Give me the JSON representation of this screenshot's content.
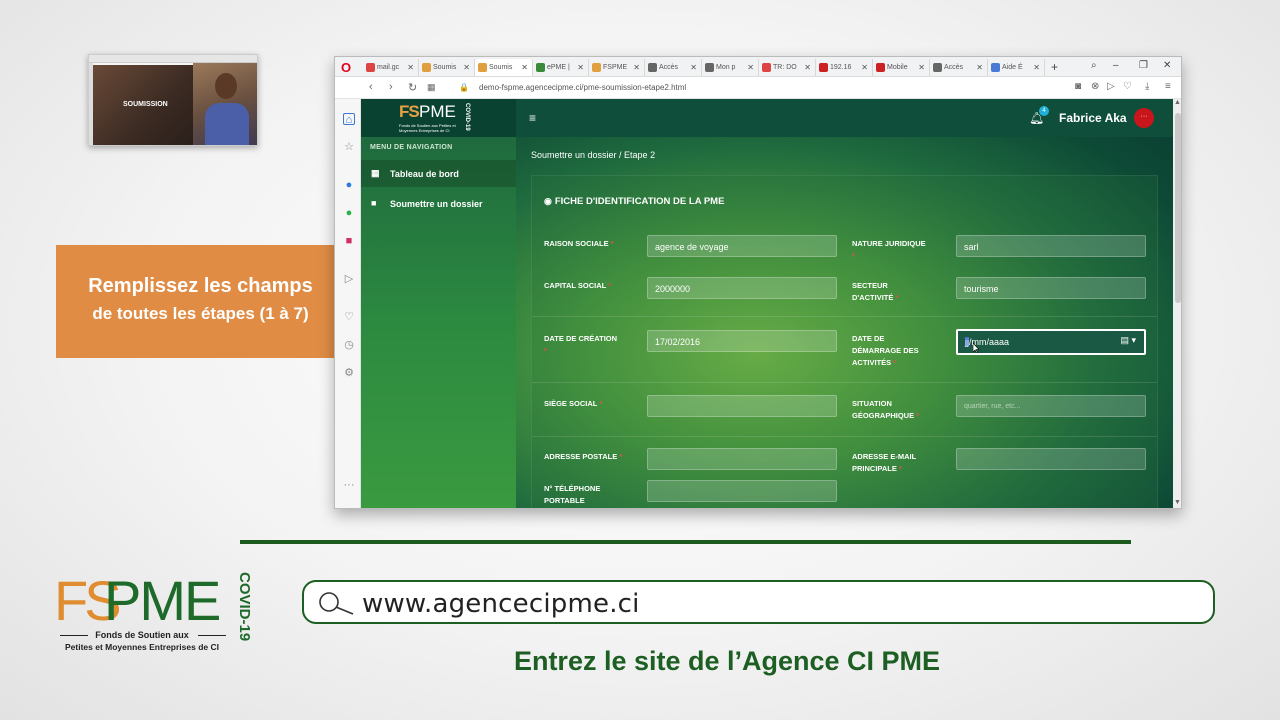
{
  "thumbnail": {
    "site_text": "SOUMISSION"
  },
  "callout": {
    "line1": "Remplissez les champs",
    "line2": "de toutes les étapes (1 à 7)"
  },
  "browser": {
    "tabs": [
      {
        "label": "mail.gc",
        "color": "#d44"
      },
      {
        "label": "Soumis",
        "color": "#e0a040"
      },
      {
        "label": "Soumis",
        "color": "#e0a040",
        "active": true
      },
      {
        "label": "ePME |",
        "color": "#3a8a3a"
      },
      {
        "label": "FSPME",
        "color": "#e0a040"
      },
      {
        "label": "Accès",
        "color": "#666"
      },
      {
        "label": "Mon p",
        "color": "#666"
      },
      {
        "label": "TR: DO",
        "color": "#d44"
      },
      {
        "label": "192.16",
        "color": "#c22"
      },
      {
        "label": "Mobile",
        "color": "#c22"
      },
      {
        "label": "Accès",
        "color": "#666"
      },
      {
        "label": "Aide É",
        "color": "#4a7ad4"
      }
    ],
    "url": "demo-fspme.agencecipme.ci/pme-soumission-etape2.html"
  },
  "app": {
    "logo_fs": "FS",
    "logo_pme": "PME",
    "logo_sub": "Fonds de Soutien aux Petites et Moyennes Entreprises de CI",
    "logo_covid": "COVID-19",
    "notif_count": "4",
    "user_name": "Fabrice Aka",
    "avatar": "···",
    "nav_title": "MENU DE NAVIGATION",
    "nav_items": [
      "Tableau de bord",
      "Soumettre un dossier"
    ],
    "breadcrumb": "Soumettre un dossier  /  Etape 2",
    "card_title": "FICHE D'IDENTIFICATION DE LA PME",
    "fields": {
      "raison_sociale": {
        "label": "RAISON SOCIALE",
        "value": "agence de voyage"
      },
      "nature_juridique": {
        "label": "NATURE JURIDIQUE",
        "value": "sarl"
      },
      "capital_social": {
        "label": "CAPITAL SOCIAL",
        "value": "2000000"
      },
      "secteur_activite": {
        "label1": "SECTEUR",
        "label2": "D'ACTIVITÉ",
        "value": "tourisme"
      },
      "date_creation": {
        "label": "DATE DE CRÉATION",
        "value": "17/02/2016"
      },
      "date_demarrage": {
        "label1": "DATE DE",
        "label2": "DÉMARRAGE DES",
        "label3": "ACTIVITÉS",
        "value_sel": "jj",
        "value_rest": "/mm/aaaa"
      },
      "siege_social": {
        "label": "SIÈGE SOCIAL",
        "value": ""
      },
      "situation_geo": {
        "label1": "SITUATION",
        "label2": "GÉOGRAPHIQUE",
        "placeholder": "quartier, rue, etc..."
      },
      "adresse_postale": {
        "label": "ADRESSE POSTALE",
        "value": ""
      },
      "adresse_email": {
        "label1": "ADRESSE E-MAIL",
        "label2": "PRINCIPALE",
        "value": ""
      },
      "telephone": {
        "label1": "N° TÉLÉPHONE",
        "label2": "PORTABLE",
        "value": ""
      }
    }
  },
  "bottom": {
    "logo_fs": "FS",
    "logo_pme": "PME",
    "logo_covid": "COVID-19",
    "logo_sub1": "Fonds de Soutien aux",
    "logo_sub2": "Petites et Moyennes Entreprises de CI",
    "search_text": "www.agencecipme.ci",
    "caption": "Entrez le site de l’Agence CI PME"
  },
  "colors": {
    "brand_green": "#1d5e22",
    "brand_orange": "#e08c45",
    "required_red": "#e05050"
  }
}
